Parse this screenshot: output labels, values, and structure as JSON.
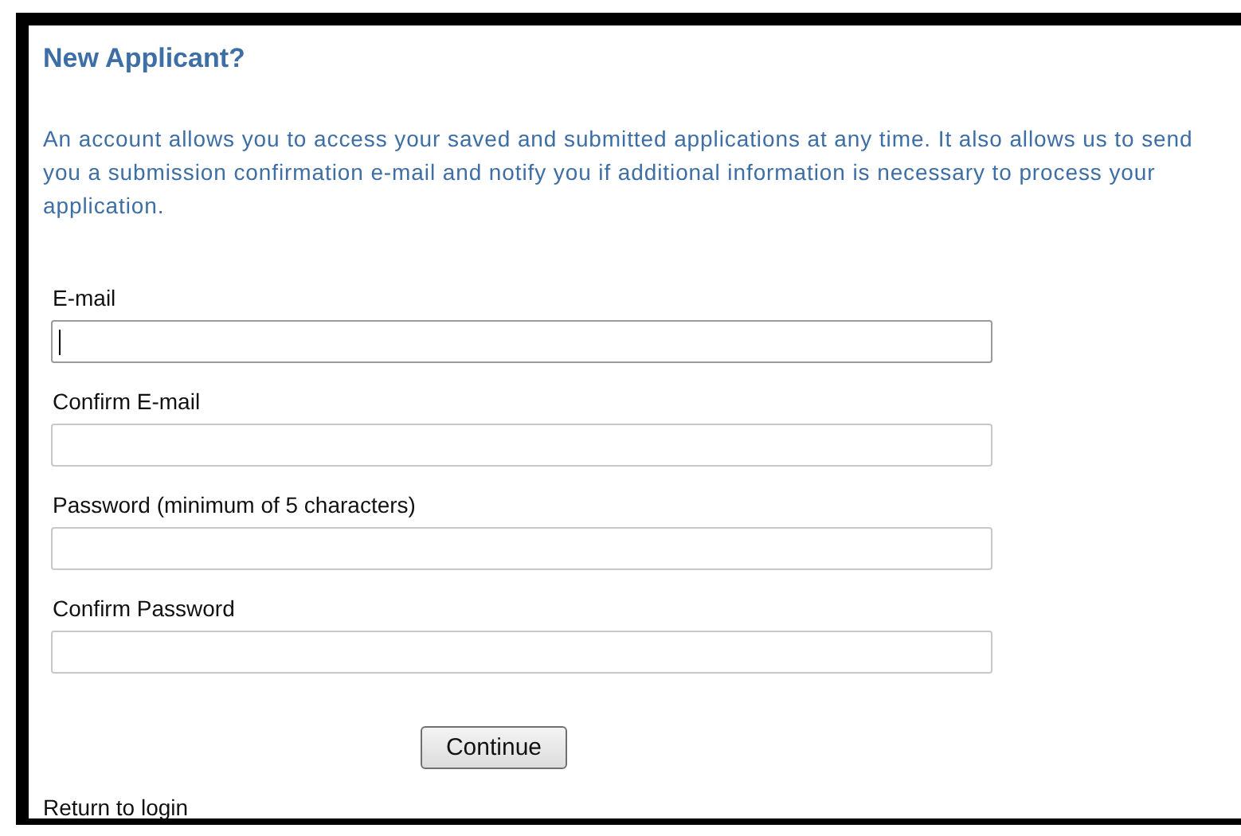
{
  "heading": "New Applicant?",
  "intro": "An account allows you to access your saved and submitted applications at any time. It also allows us to send you a submission confirmation e-mail and notify you if additional information is necessary to process your application.",
  "fields": [
    {
      "label": "E-mail",
      "focused": true
    },
    {
      "label": "Confirm E-mail",
      "focused": false
    },
    {
      "label": "Password (minimum of 5 characters)",
      "focused": false
    },
    {
      "label": "Confirm Password",
      "focused": false
    }
  ],
  "button": "Continue",
  "link": "Return to login"
}
